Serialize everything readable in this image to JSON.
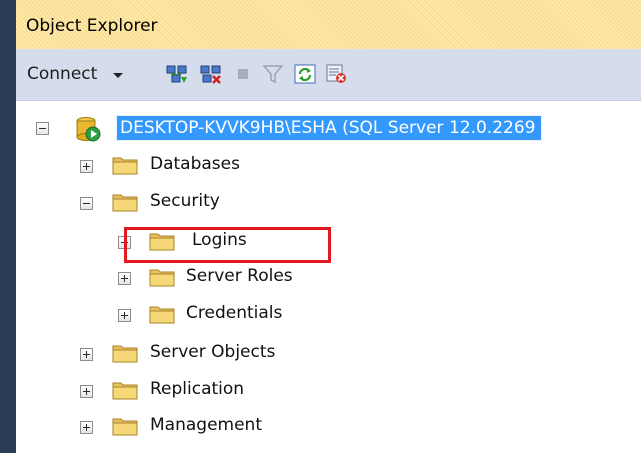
{
  "panel": {
    "title": "Object Explorer"
  },
  "toolbar": {
    "connect_label": "Connect",
    "icons": [
      "connect-object-explorer-icon",
      "disconnect-icon",
      "stop-icon",
      "filter-icon",
      "refresh-icon",
      "activity-monitor-icon"
    ]
  },
  "tree": {
    "server": "DESKTOP-KVVK9HB\\ESHA (SQL Server 12.0.2269",
    "nodes": {
      "databases": "Databases",
      "security": "Security",
      "logins": "Logins",
      "server_roles": "Server Roles",
      "credentials": "Credentials",
      "server_objects": "Server Objects",
      "replication": "Replication",
      "management": "Management"
    }
  },
  "colors": {
    "selection": "#3399ff",
    "highlight_box": "#e0181f",
    "title_bar": "#ffe8a6",
    "toolbar": "#d5dcec"
  }
}
